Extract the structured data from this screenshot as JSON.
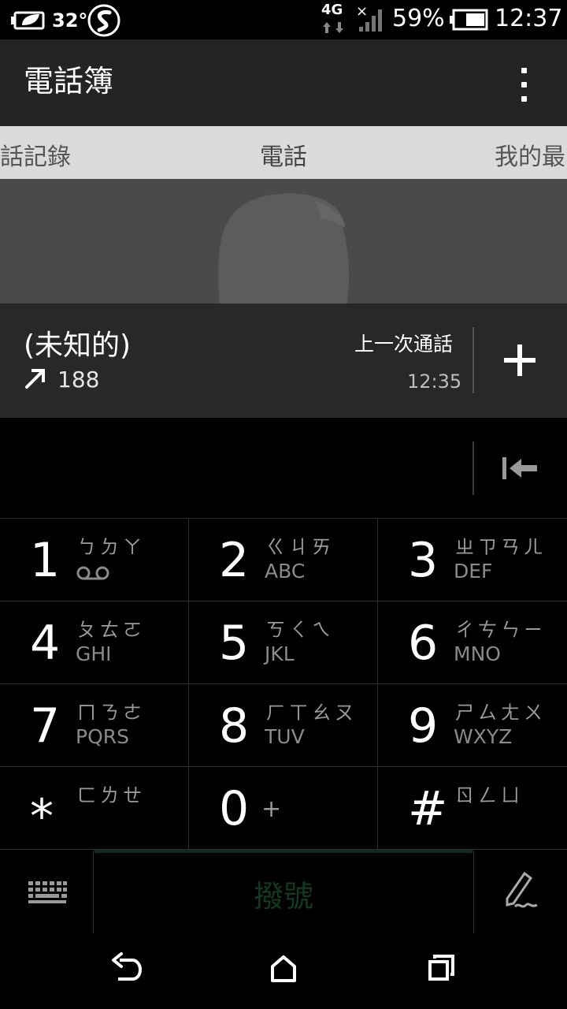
{
  "status_bar": {
    "temperature": "32°",
    "network_type": "4G",
    "battery_percent": "59%",
    "time": "12:37"
  },
  "app_bar": {
    "title": "電話簿"
  },
  "tabs": [
    {
      "label": "話記錄"
    },
    {
      "label": "電話"
    },
    {
      "label": "我的最"
    }
  ],
  "contact": {
    "name": "(未知的)",
    "number": "188",
    "last_call_label": "上一次通話",
    "last_call_time": "12:35"
  },
  "number_entry": {
    "value": ""
  },
  "keypad": {
    "keys": [
      {
        "digit": "1",
        "bopomofo": "ㄅㄉㄚ",
        "letters": ""
      },
      {
        "digit": "2",
        "bopomofo": "ㄍㄐㄞ",
        "letters": "ABC"
      },
      {
        "digit": "3",
        "bopomofo": "ㄓㄗㄢㄦ",
        "letters": "DEF"
      },
      {
        "digit": "4",
        "bopomofo": "ㄆㄊㄛ",
        "letters": "GHI"
      },
      {
        "digit": "5",
        "bopomofo": "ㄎㄑㄟ",
        "letters": "JKL"
      },
      {
        "digit": "6",
        "bopomofo": "ㄔㄘㄣㄧ",
        "letters": "MNO"
      },
      {
        "digit": "7",
        "bopomofo": "ㄇㄋㄜ",
        "letters": "PQRS"
      },
      {
        "digit": "8",
        "bopomofo": "ㄏㄒㄠㄡ",
        "letters": "TUV"
      },
      {
        "digit": "9",
        "bopomofo": "ㄕㄙㄤㄨ",
        "letters": "WXYZ"
      },
      {
        "digit": "*",
        "bopomofo": "ㄈㄌㄝ",
        "letters": ""
      },
      {
        "digit": "0",
        "bopomofo": "+",
        "letters": ""
      },
      {
        "digit": "#",
        "bopomofo": "ㄖㄥㄩ",
        "letters": ""
      }
    ]
  },
  "action_bar": {
    "dial_label": "撥號"
  },
  "icons": {
    "status_left": [
      "battery-saver-leaf-icon",
      "weather-icon",
      "s-app-icon"
    ],
    "status_right": [
      "4g-data-icon",
      "signal-icon",
      "battery-icon"
    ],
    "app_bar": [
      "overflow-menu-icon"
    ],
    "contact": [
      "contact-silhouette-icon",
      "outgoing-call-arrow-icon",
      "add-icon"
    ],
    "entry": [
      "backspace-icon"
    ],
    "keypad": [
      "voicemail-icon"
    ],
    "action_bar": [
      "keyboard-icon",
      "handwriting-pen-icon"
    ],
    "nav": [
      "back-icon",
      "home-icon",
      "recent-apps-icon"
    ]
  },
  "colors": {
    "tab_bar_bg": "#d9dcda",
    "app_bar_bg": "#242424",
    "dial_disabled_text": "#103a22"
  }
}
